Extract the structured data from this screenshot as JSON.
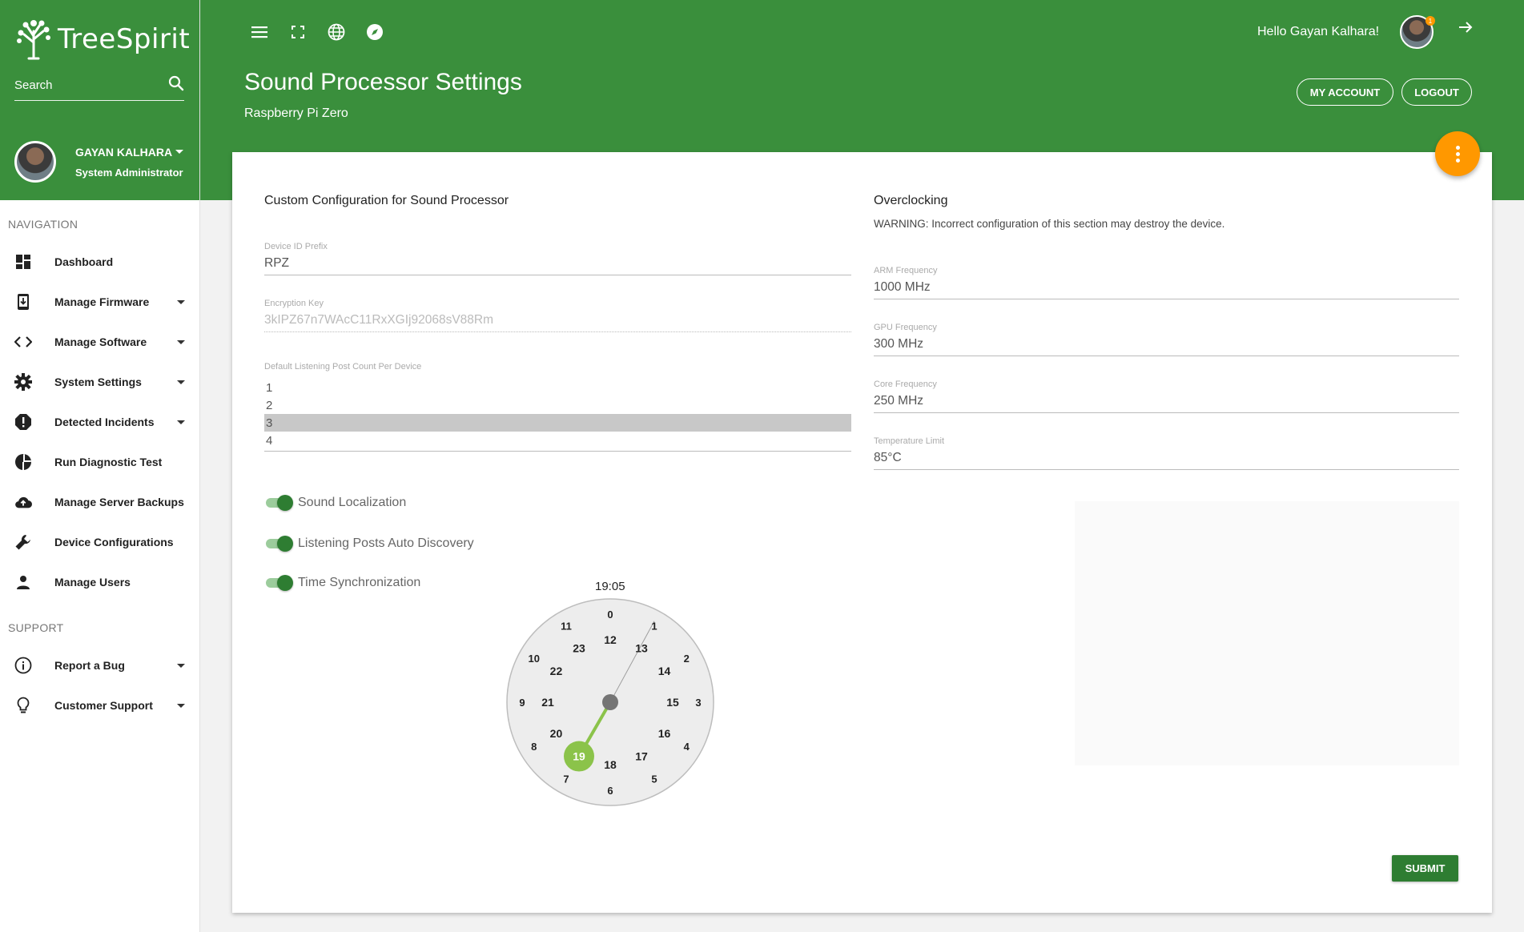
{
  "brand": {
    "name": "TreeSpirit"
  },
  "sidebar": {
    "search_placeholder": "Search",
    "user": {
      "name": "GAYAN KALHARA",
      "role": "System Administrator"
    },
    "sections": {
      "navigation": "NAVIGATION",
      "support": "SUPPORT"
    },
    "nav_items": [
      {
        "label": "Dashboard",
        "icon": "dashboard-icon",
        "has_caret": false
      },
      {
        "label": "Manage Firmware",
        "icon": "firmware-icon",
        "has_caret": true
      },
      {
        "label": "Manage Software",
        "icon": "code-icon",
        "has_caret": true
      },
      {
        "label": "System Settings",
        "icon": "gear-icon",
        "has_caret": true
      },
      {
        "label": "Detected Incidents",
        "icon": "alert-icon",
        "has_caret": true
      },
      {
        "label": "Run Diagnostic Test",
        "icon": "pie-chart-icon",
        "has_caret": false
      },
      {
        "label": "Manage Server Backups",
        "icon": "cloud-upload-icon",
        "has_caret": false
      },
      {
        "label": "Device Configurations",
        "icon": "wrench-icon",
        "has_caret": false
      },
      {
        "label": "Manage Users",
        "icon": "person-icon",
        "has_caret": false
      }
    ],
    "support_items": [
      {
        "label": "Report a Bug",
        "icon": "info-icon",
        "has_caret": true
      },
      {
        "label": "Customer Support",
        "icon": "lightbulb-icon",
        "has_caret": true
      }
    ]
  },
  "header": {
    "title": "Sound Processor Settings",
    "subtitle": "Raspberry Pi Zero",
    "greeting": "Hello Gayan Kalhara!",
    "notification_count": "1",
    "my_account_label": "MY ACCOUNT",
    "logout_label": "LOGOUT",
    "icons": [
      "menu-icon",
      "fullscreen-icon",
      "globe-icon",
      "compass-icon"
    ]
  },
  "form": {
    "left_title": "Custom Configuration for Sound Processor",
    "device_id_prefix": {
      "label": "Device ID Prefix",
      "value": "RPZ"
    },
    "encryption_key": {
      "label": "Encryption Key",
      "value": "3kIPZ67n7WAcC11RxXGIj92068sV88Rm"
    },
    "listening_post_count": {
      "label": "Default Listening Post Count Per Device",
      "options": [
        "1",
        "2",
        "3",
        "4"
      ],
      "selected": "3"
    },
    "toggles": [
      {
        "label": "Sound Localization",
        "checked": true
      },
      {
        "label": "Listening Posts Auto Discovery",
        "checked": true
      },
      {
        "label": "Time Synchronization",
        "checked": true
      }
    ],
    "time_picker": {
      "time": "19:05",
      "selected_hour": 19,
      "outer_hours": [
        "0",
        "1",
        "2",
        "3",
        "4",
        "5",
        "6",
        "7",
        "8",
        "9",
        "10",
        "11"
      ],
      "inner_hours": [
        "12",
        "13",
        "14",
        "15",
        "16",
        "17",
        "18",
        "19",
        "20",
        "21",
        "22",
        "23"
      ]
    },
    "right_title": "Overclocking",
    "warning": "WARNING: Incorrect configuration of this section may destroy the device.",
    "arm_frequency": {
      "label": "ARM Frequency",
      "value": "1000 MHz"
    },
    "gpu_frequency": {
      "label": "GPU Frequency",
      "value": "300 MHz"
    },
    "core_frequency": {
      "label": "Core Frequency",
      "value": "250 MHz"
    },
    "temperature_limit": {
      "label": "Temperature Limit",
      "value": "85°C"
    },
    "submit_label": "SUBMIT"
  },
  "colors": {
    "primary": "#3a8f3c",
    "accent": "#ff9800",
    "submit": "#2e7d32",
    "clock_selected": "#8bc34a"
  }
}
